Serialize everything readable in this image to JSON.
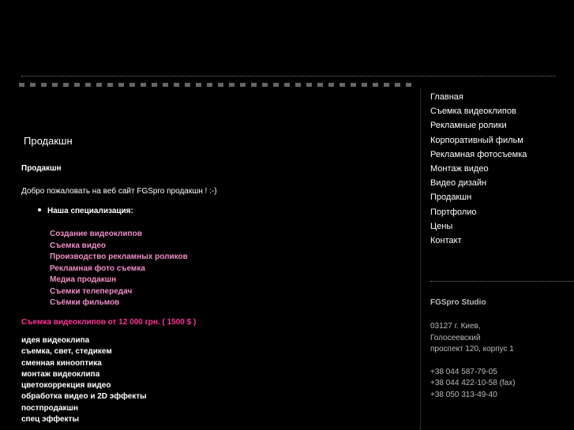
{
  "page": {
    "title": "Продакшн",
    "subtitle": "Продакшн",
    "welcome": "Добро пожаловать на веб сайт FGSpro продакшн ! :-)",
    "specialization_label": "Наша специализация:",
    "specialization_links": [
      "Создание видеоклипов",
      "Съемка видео",
      "Производство рекламных роликов",
      "Рекламная фото съемка",
      "Медиа продакшн",
      "Съемки телепередач",
      "Съёмки фильмов"
    ],
    "price_line": "Съемка видеоклипов от 12 000 грн. ( 1500 $ )",
    "services": [
      "идея видеоклипа",
      "съемка, свет, стедикем",
      "сменная кинооптика",
      "монтаж видеоклипа",
      "цветокоррекция видео",
      "обработка видео и 2D эффекты",
      "постпродакшн",
      "спец эффекты"
    ]
  },
  "nav": {
    "items": [
      "Главная",
      "Съемка видеоклипов",
      "Рекламные ролики",
      "Корпоративный фильм",
      "Рекламная фотосъемка",
      "Монтаж видео",
      "Видео дизайн",
      "Продакшн",
      "Портфолио",
      "Цены",
      "Контакт"
    ]
  },
  "contact": {
    "studio": "FGSpro Studio",
    "address": [
      "03127 г. Киев,",
      "Голосеевский",
      "проспект 120, корпус 1"
    ],
    "phones": [
      "+38 044 587-79-05",
      "+38 044 422-10-58 (fax)",
      "+38 050 313-49-40"
    ]
  },
  "colors": {
    "background": "#000000",
    "link_pink": "#f08ec8",
    "price_pink": "#ff3399"
  }
}
